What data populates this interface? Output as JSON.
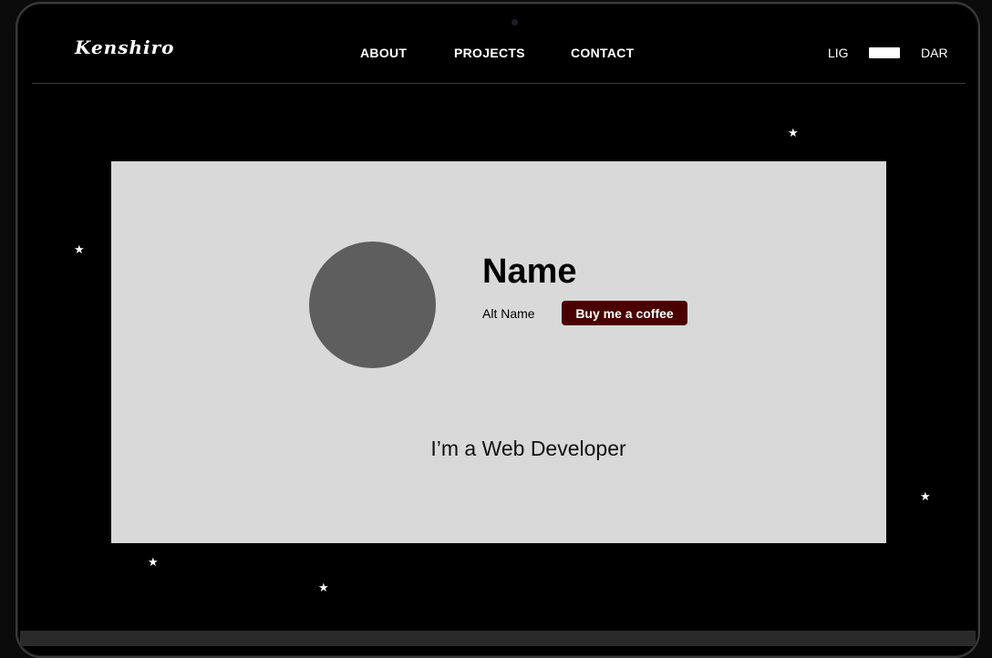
{
  "header": {
    "logo": "Kenshiro",
    "nav": {
      "about": "ABOUT",
      "projects": "PROJECTS",
      "contact": "CONTACT"
    },
    "theme": {
      "light_label": "LIG",
      "dark_label": "DAR"
    }
  },
  "hero": {
    "name": "Name",
    "alt_name": "Alt Name",
    "coffee_button": "Buy me a coffee",
    "tagline": "I’m a Web Developer"
  },
  "decor": {
    "star_glyph": "★"
  },
  "colors": {
    "background": "#000000",
    "card": "#d9d9d9",
    "avatar": "#5e5e5e",
    "coffee_button": "#4a0000"
  }
}
